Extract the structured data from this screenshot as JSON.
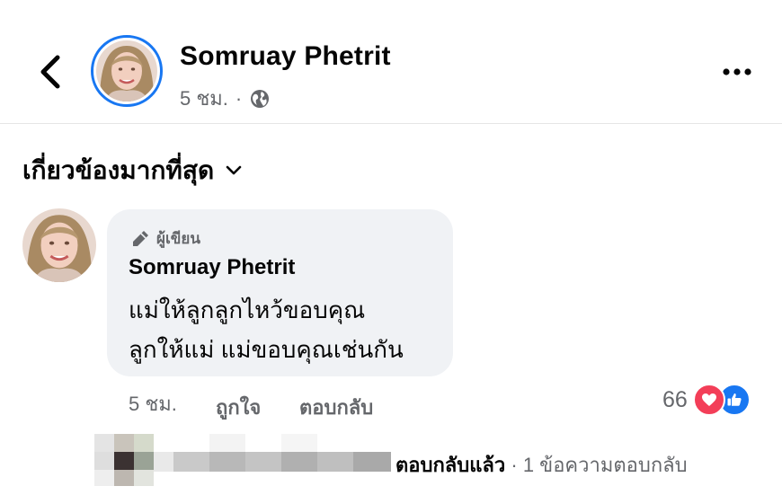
{
  "header": {
    "author_name": "Somruay Phetrit",
    "time": "5 ชม.",
    "separator": "·",
    "privacy_icon": "globe-icon",
    "back_icon": "chevron-left-icon",
    "more_icon": "more-horizontal-icon"
  },
  "sort": {
    "label": "เกี่ยวข้องมากที่สุด",
    "icon": "chevron-down-icon"
  },
  "comment": {
    "badge_label": "ผู้เขียน",
    "badge_icon": "pen-icon",
    "name": "Somruay Phetrit",
    "lines": [
      "แม่ให้ลูกลูกไหว้ขอบคุณ",
      "ลูกให้แม่ แม่ขอบคุณเช่นกัน"
    ],
    "time": "5 ชม.",
    "like_label": "ถูกใจ",
    "reply_label": "ตอบกลับ",
    "reaction_count": "66",
    "reaction_icons": [
      "heart-icon",
      "like-icon"
    ],
    "colors": {
      "heart": "#f33e58",
      "like": "#1877f2"
    }
  },
  "replies": {
    "replied_label": "ตอบกลับแล้ว",
    "separator": "·",
    "count_label": "1 ข้อความตอบกลับ"
  }
}
